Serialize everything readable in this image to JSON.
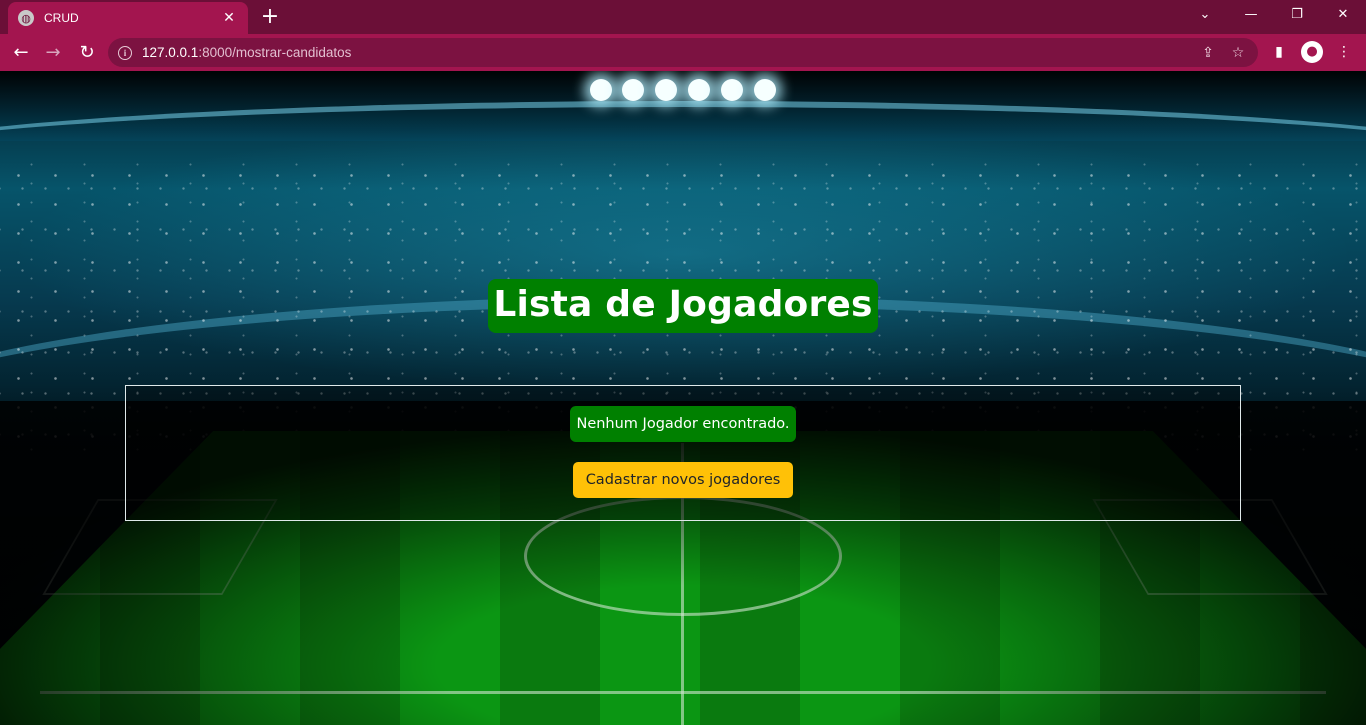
{
  "browser": {
    "tab_title": "CRUD",
    "tab_close": "✕",
    "new_tab": "+",
    "url_host": "127.0.0.1",
    "url_path": ":8000/mostrar-candidatos",
    "window_controls": {
      "dropdown": "⌄",
      "minimize": "—",
      "restore": "❐",
      "close": "✕"
    }
  },
  "page": {
    "heading": "Lista de Jogadores",
    "empty_message": "Nenhum Jogador encontrado.",
    "register_button": "Cadastrar novos jogadores"
  },
  "colors": {
    "tab_bar": "#6b0f37",
    "toolbar": "#a3154f",
    "heading_bg": "#008000",
    "button_bg": "#ffc107"
  },
  "icons": [
    "globe-icon",
    "back-icon",
    "forward-icon",
    "reload-icon",
    "info-icon",
    "share-icon",
    "star-icon",
    "sidepanel-icon",
    "profile-icon",
    "menu-icon"
  ]
}
